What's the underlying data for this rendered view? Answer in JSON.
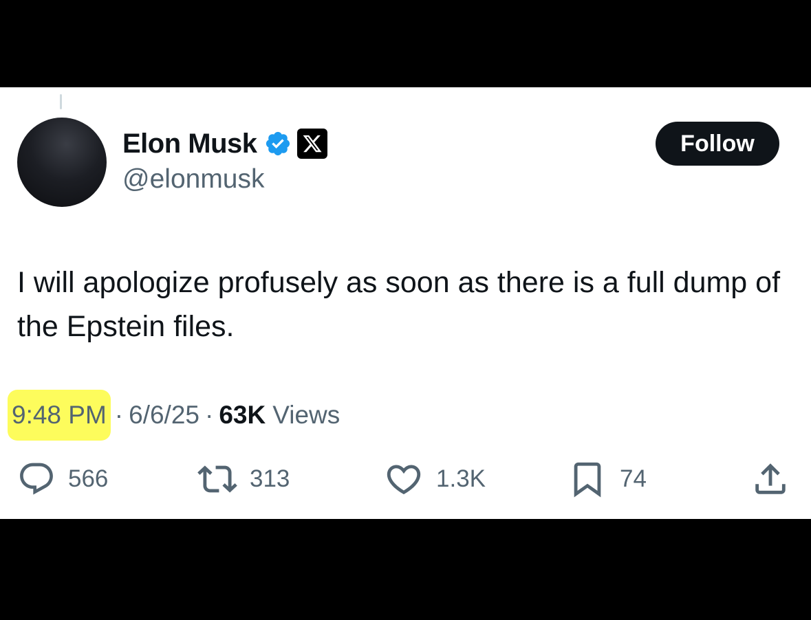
{
  "author": {
    "display_name": "Elon Musk",
    "handle": "@elonmusk",
    "verified_icon": "verified-badge-icon",
    "affiliation_icon": "x-logo-icon"
  },
  "follow_button": {
    "label": "Follow"
  },
  "tweet": {
    "text": "I will apologize profusely as soon as there is a full dump of the Epstein files.",
    "time": "9:48 PM",
    "separator": "·",
    "date": "6/6/25",
    "views_count": "63K",
    "views_label": "Views"
  },
  "actions": {
    "replies": "566",
    "reposts": "313",
    "likes": "1.3K",
    "bookmarks": "74"
  },
  "colors": {
    "primary_text": "#0f1419",
    "secondary_text": "#536471",
    "verified_blue": "#1d9bf0",
    "highlight": "#fdfc5c"
  }
}
